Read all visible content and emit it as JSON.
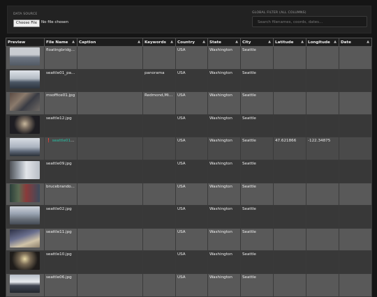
{
  "header": {
    "data_source_label": "DATA SOURCE",
    "file_button_label": "Choose File",
    "file_status": "No file chosen",
    "global_filter_label": "GLOBAL FILTER (ALL COLUMNS)",
    "search_placeholder": "Search filenames, coords, dates..."
  },
  "columns": [
    {
      "label": "Preview",
      "sortable": false
    },
    {
      "label": "File Name",
      "sortable": true
    },
    {
      "label": "Caption",
      "sortable": true
    },
    {
      "label": "Keywords",
      "sortable": true
    },
    {
      "label": "Country",
      "sortable": true
    },
    {
      "label": "State",
      "sortable": true
    },
    {
      "label": "City",
      "sortable": true
    },
    {
      "label": "Latitude",
      "sortable": true
    },
    {
      "label": "Longitude",
      "sortable": true
    },
    {
      "label": "Date",
      "sortable": true
    }
  ],
  "sort_glyph": "▲",
  "warning_glyph": "❗",
  "rows": [
    {
      "thumb": "t0",
      "file": "floatingbridg...",
      "caption": "",
      "keywords": "",
      "country": "USA",
      "state": "Washington",
      "city": "Seattle",
      "lat": "",
      "lon": "",
      "date": ""
    },
    {
      "thumb": "t1",
      "file": "seattle01_pa...",
      "caption": "",
      "keywords": "panorama",
      "country": "USA",
      "state": "Washington",
      "city": "Seattle",
      "lat": "",
      "lon": "",
      "date": ""
    },
    {
      "thumb": "t2",
      "file": "msoffice01.jpg",
      "caption": "",
      "keywords": "Redmond,Mic...",
      "country": "USA",
      "state": "Washington",
      "city": "Seattle",
      "lat": "",
      "lon": "",
      "date": ""
    },
    {
      "thumb": "t3",
      "file": "seattle12.jpg",
      "caption": "",
      "keywords": "",
      "country": "USA",
      "state": "Washington",
      "city": "Seattle",
      "lat": "",
      "lon": "",
      "date": ""
    },
    {
      "thumb": "t4",
      "file": "seattle01.j...",
      "caption": "",
      "keywords": "",
      "country": "USA",
      "state": "Washington",
      "city": "Seattle",
      "lat": "47.621866",
      "lon": "-122.34875",
      "date": "",
      "selected": true,
      "warning": true
    },
    {
      "thumb": "t5",
      "file": "seattle09.jpg",
      "caption": "",
      "keywords": "",
      "country": "USA",
      "state": "Washington",
      "city": "Seattle",
      "lat": "",
      "lon": "",
      "date": ""
    },
    {
      "thumb": "t6",
      "file": "brucebrando...",
      "caption": "",
      "keywords": "",
      "country": "USA",
      "state": "Washington",
      "city": "Seattle",
      "lat": "",
      "lon": "",
      "date": ""
    },
    {
      "thumb": "t7",
      "file": "seattle02.jpg",
      "caption": "",
      "keywords": "",
      "country": "USA",
      "state": "Washington",
      "city": "Seattle",
      "lat": "",
      "lon": "",
      "date": ""
    },
    {
      "thumb": "t8",
      "file": "seattle11.jpg",
      "caption": "",
      "keywords": "",
      "country": "USA",
      "state": "Washington",
      "city": "Seattle",
      "lat": "",
      "lon": "",
      "date": ""
    },
    {
      "thumb": "t9",
      "file": "seattle10.jpg",
      "caption": "",
      "keywords": "",
      "country": "USA",
      "state": "Washington",
      "city": "Seattle",
      "lat": "",
      "lon": "",
      "date": ""
    },
    {
      "thumb": "t10",
      "file": "seattle06.jpg",
      "caption": "",
      "keywords": "",
      "country": "USA",
      "state": "Washington",
      "city": "Seattle",
      "lat": "",
      "lon": "",
      "date": ""
    }
  ]
}
